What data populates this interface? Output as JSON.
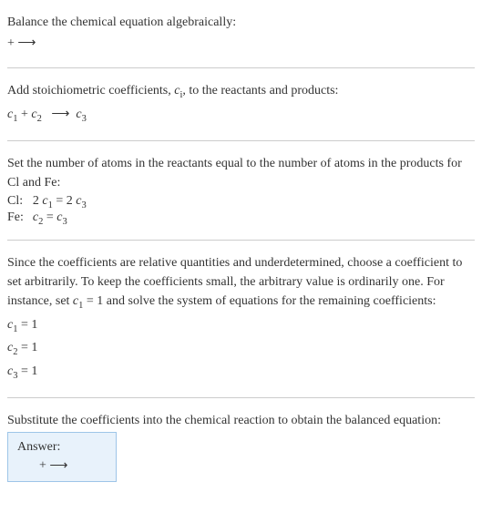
{
  "section1": {
    "title": "Balance the chemical equation algebraically:",
    "equation_prefix": " + ",
    "arrow": "⟶"
  },
  "section2": {
    "title_part1": "Add stoichiometric coefficients, ",
    "title_var": "c",
    "title_sub": "i",
    "title_part2": ", to the reactants and products:",
    "c1": "c",
    "c1_sub": "1",
    "plus": " + ",
    "c2": "c",
    "c2_sub": "2",
    "arrow": "⟶",
    "c3": "c",
    "c3_sub": "3"
  },
  "section3": {
    "title": "Set the number of atoms in the reactants equal to the number of atoms in the products for Cl and Fe:",
    "rows": [
      {
        "label": "Cl: ",
        "eq_lhs1": "2 ",
        "eq_c1": "c",
        "eq_s1": "1",
        "eq_eq": " = 2 ",
        "eq_c2": "c",
        "eq_s2": "3"
      },
      {
        "label": "Fe: ",
        "eq_lhs1": "",
        "eq_c1": "c",
        "eq_s1": "2",
        "eq_eq": " = ",
        "eq_c2": "c",
        "eq_s2": "3"
      }
    ]
  },
  "section4": {
    "text_part1": "Since the coefficients are relative quantities and underdetermined, choose a coefficient to set arbitrarily. To keep the coefficients small, the arbitrary value is ordinarily one. For instance, set ",
    "var_c": "c",
    "var_sub": "1",
    "text_part2": " = 1 and solve the system of equations for the remaining coefficients:",
    "results": [
      {
        "c": "c",
        "s": "1",
        "v": " = 1"
      },
      {
        "c": "c",
        "s": "2",
        "v": " = 1"
      },
      {
        "c": "c",
        "s": "3",
        "v": " = 1"
      }
    ]
  },
  "section5": {
    "title": "Substitute the coefficients into the chemical reaction to obtain the balanced equation:"
  },
  "answer": {
    "label": "Answer:",
    "prefix": " + ",
    "arrow": "⟶"
  }
}
